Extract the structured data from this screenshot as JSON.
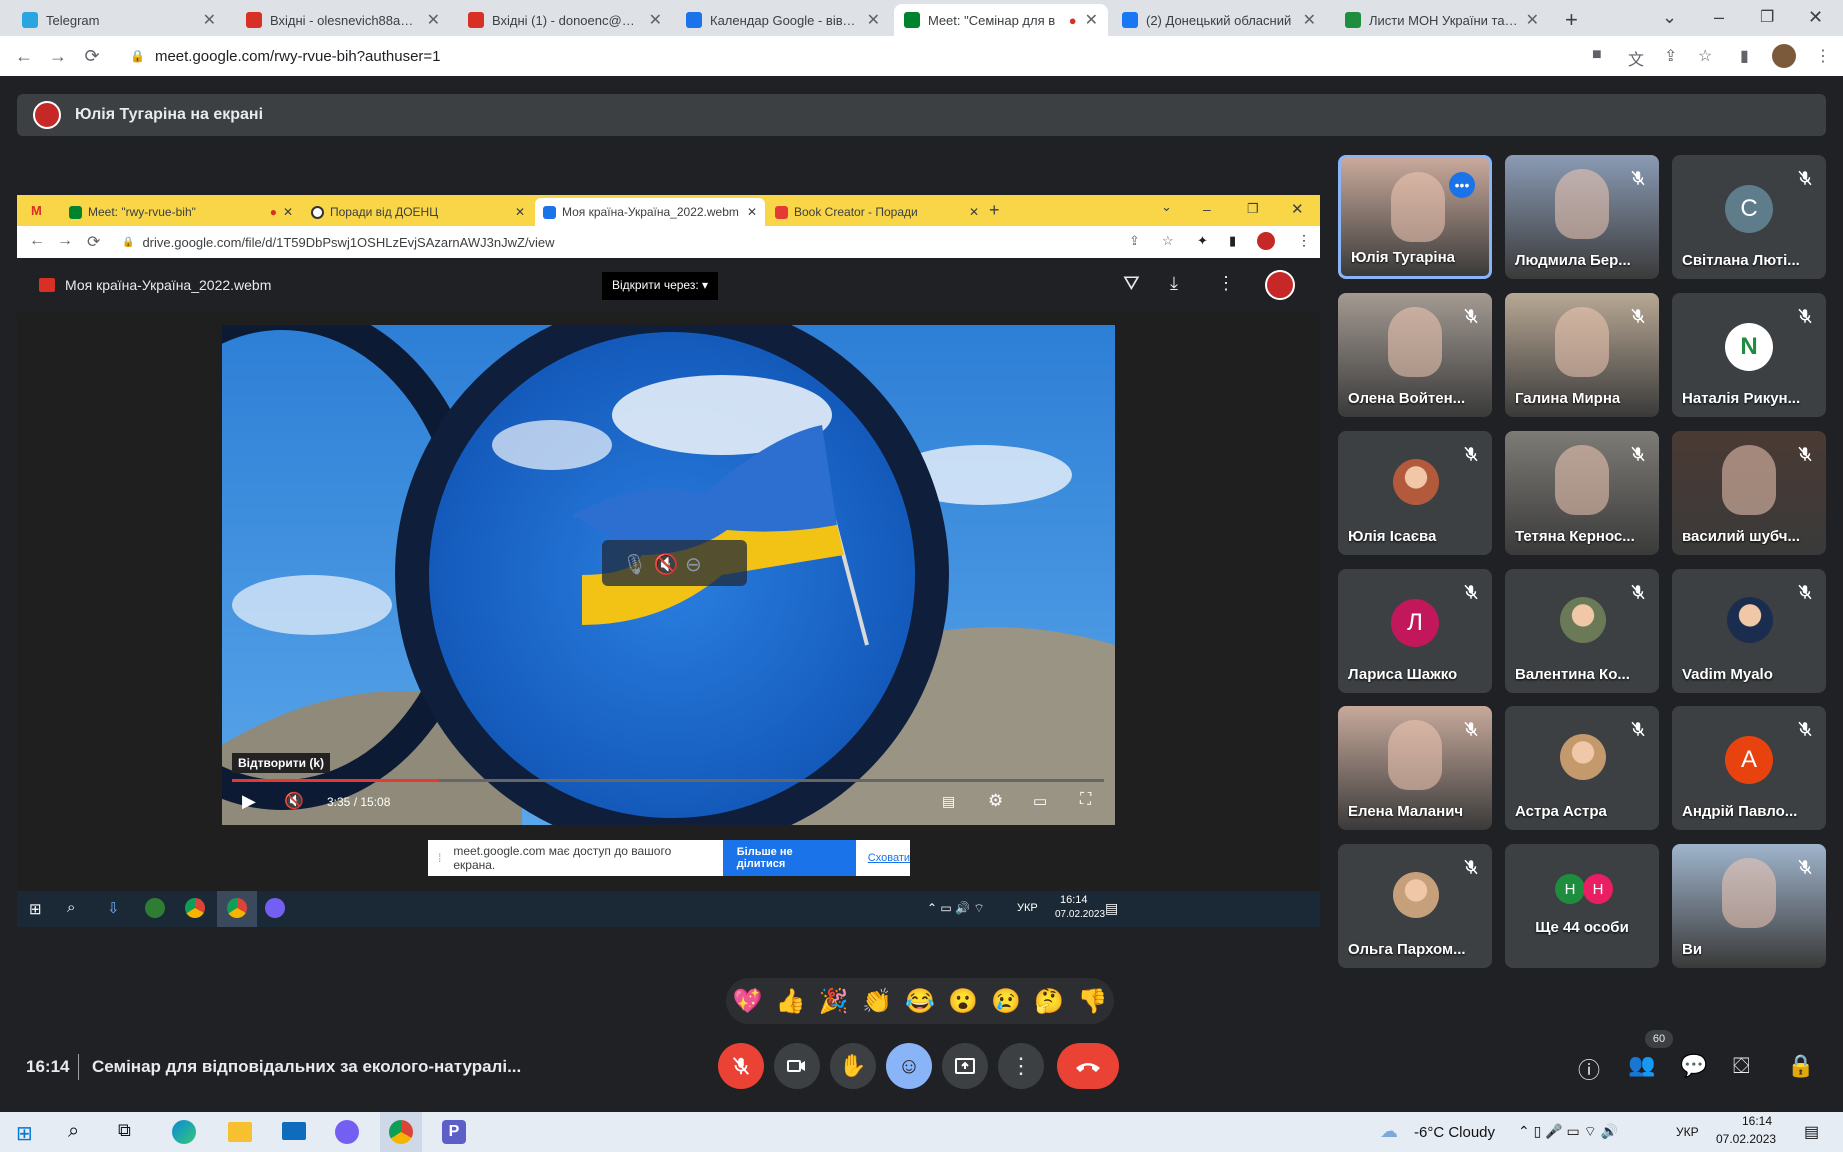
{
  "browser": {
    "tabs": [
      {
        "label": "Telegram",
        "color": "#2aa5e0"
      },
      {
        "label": "Вхідні - olesnevich88a@gm",
        "color": "#d93025"
      },
      {
        "label": "Вхідні (1) - donoenc@gma",
        "color": "#d93025"
      },
      {
        "label": "Календар Google - вівтор",
        "color": "#1a73e8"
      },
      {
        "label": "Meet: \"Семінар для в",
        "color": "#00832d"
      },
      {
        "label": "(2) Донецький обласний",
        "color": "#1877f2"
      },
      {
        "label": "Листи МОН України та НУ",
        "color": "#1e8e3e"
      }
    ],
    "url": "meet.google.com/rwy-rvue-bih?authuser=1"
  },
  "meet": {
    "presenter_label": "Юлія Тугаріна на екрані",
    "time": "16:14",
    "meeting_title": "Семінар для відповідальних за еколого-натуралі...",
    "people_count": "60",
    "reactions": [
      "💖",
      "👍",
      "🎉",
      "👏",
      "😂",
      "😮",
      "😢",
      "🤔",
      "👎"
    ]
  },
  "shared": {
    "tabs": [
      {
        "label": "Meet: \"rwy-rvue-bih\""
      },
      {
        "label": "Поради від ДОЕНЦ"
      },
      {
        "label": "Моя країна-Україна_2022.webm"
      },
      {
        "label": "Book Creator - Поради"
      }
    ],
    "url": "drive.google.com/file/d/1T59DbPswj1OSHLzEvjSAzarnAWJ3nJwZ/view",
    "file_name": "Моя країна-Україна_2022.webm",
    "open_with": "Відкрити через:",
    "play_tooltip": "Відтворити (k)",
    "time_display": "3:35 / 15:08",
    "progress": 0.237,
    "share_notice": "meet.google.com має доступ до вашого екрана.",
    "stop_sharing": "Більше не ділитися",
    "hide": "Сховати",
    "lang": "УКР",
    "clock_time": "16:14",
    "clock_date": "07.02.2023"
  },
  "participants": [
    {
      "name": "Юлія Тугаріна",
      "type": "video",
      "color": "#c9a99b"
    },
    {
      "name": "Людмила Бер...",
      "type": "video",
      "color": "#8a9bb4"
    },
    {
      "name": "Світлана Люті...",
      "type": "letter",
      "letter": "С",
      "color": "#5f7c8a"
    },
    {
      "name": "Олена Войтен...",
      "type": "video",
      "color": "#a39a92"
    },
    {
      "name": "Галина Мирна",
      "type": "video",
      "color": "#b8a894"
    },
    {
      "name": "Наталія Рикун...",
      "type": "letter",
      "letter": "N",
      "color": "#ffffff"
    },
    {
      "name": "Юлія Ісаєва",
      "type": "photo",
      "color": "#b45a3c"
    },
    {
      "name": "Тетяна Кернос...",
      "type": "video",
      "color": "#7d7b76"
    },
    {
      "name": "василий шубч...",
      "type": "video",
      "color": "#4a3a34"
    },
    {
      "name": "Лариса Шажко",
      "type": "letter",
      "letter": "Л",
      "color": "#c2185b"
    },
    {
      "name": "Валентина Ко...",
      "type": "photo",
      "color": "#6b7a56"
    },
    {
      "name": "Vadim Myalo",
      "type": "photo",
      "color": "#1a2d4e"
    },
    {
      "name": "Елена Маланич",
      "type": "video",
      "color": "#c7a99b"
    },
    {
      "name": "Астра Астра",
      "type": "photo",
      "color": "#c49a6c"
    },
    {
      "name": "Андрій Павло...",
      "type": "letter",
      "letter": "А",
      "color": "#e8430f"
    },
    {
      "name": "Ольга Пархом...",
      "type": "photo",
      "color": "#c6a07a"
    },
    {
      "name": "Ще 44 особи",
      "type": "more",
      "color": "#3c4043"
    },
    {
      "name": "Ви",
      "type": "video",
      "color": "#9fb4cc"
    }
  ],
  "more_avatars": [
    {
      "letter": "Н",
      "color": "#1e8e3e"
    },
    {
      "letter": "Н",
      "color": "#e91e63"
    }
  ],
  "windows": {
    "weather": "-6°C  Cloudy",
    "lang": "УКР",
    "time": "16:14",
    "date": "07.02.2023"
  }
}
